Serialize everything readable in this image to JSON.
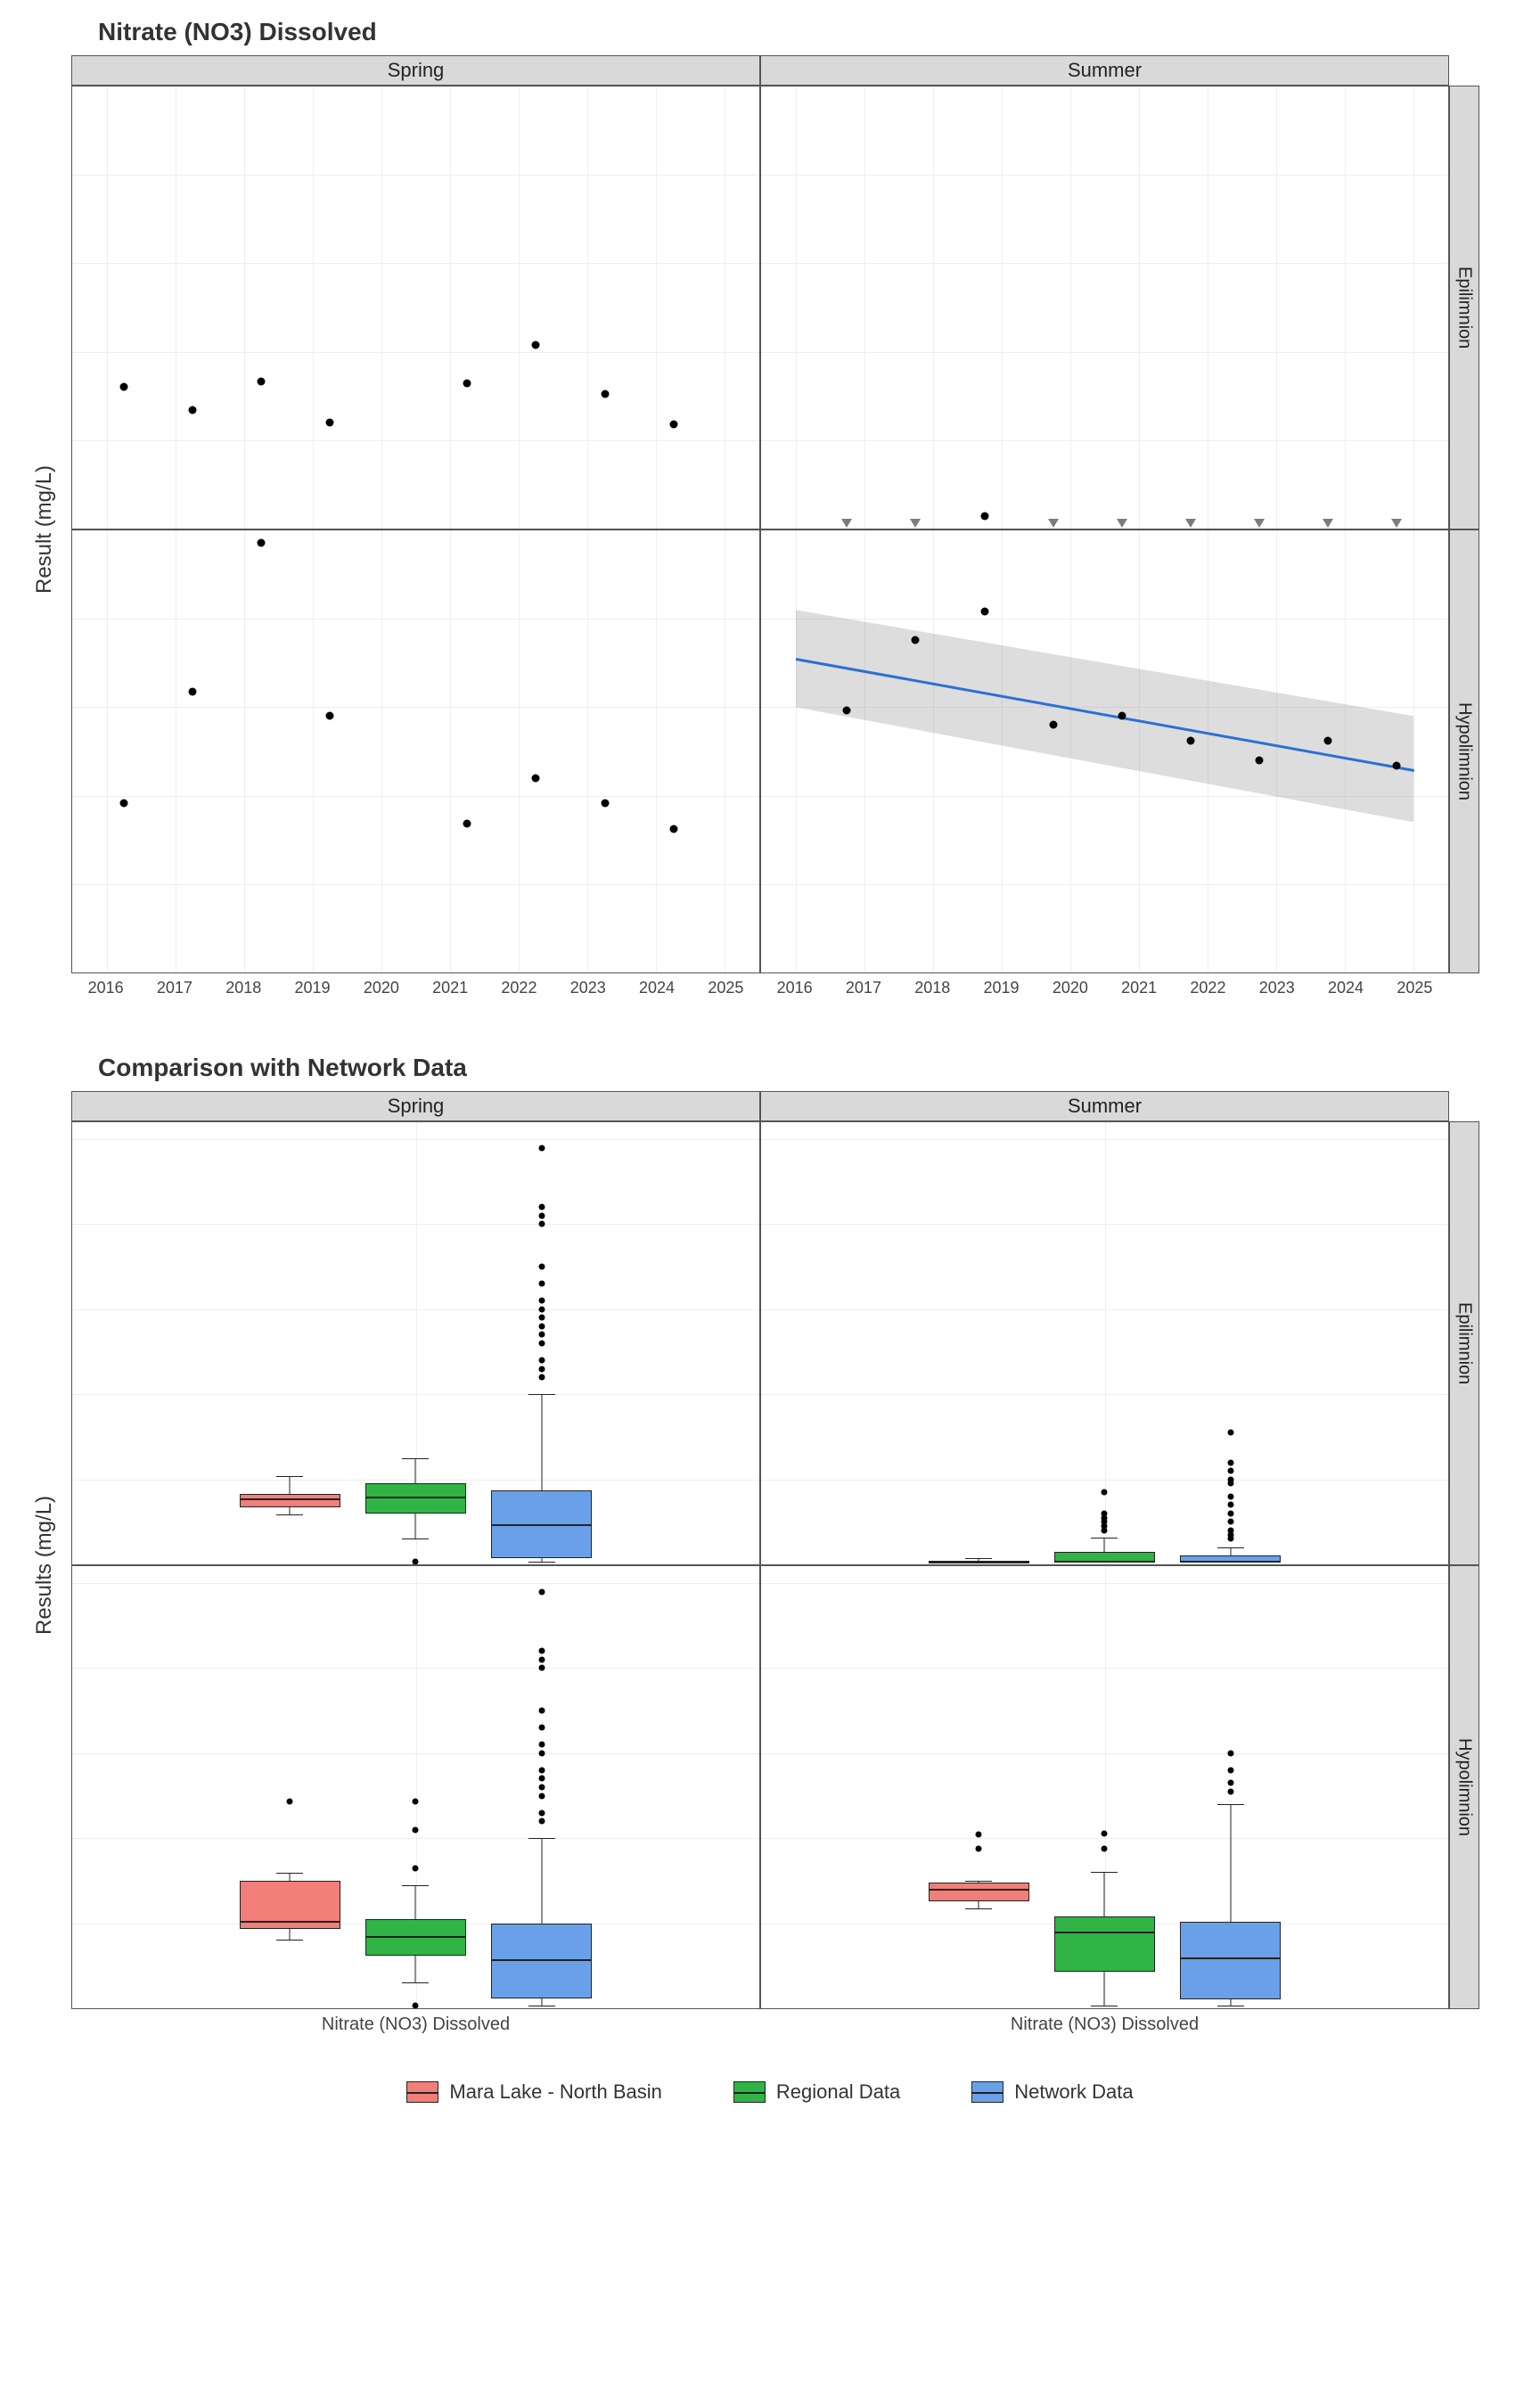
{
  "chart_data": [
    {
      "type": "scatter",
      "title": "Nitrate (NO3) Dissolved",
      "ylabel": "Result (mg/L)",
      "facet_cols": [
        "Spring",
        "Summer"
      ],
      "facet_rows": [
        "Epilimnion",
        "Hypolimnion"
      ],
      "xlim": [
        2015.5,
        2025.5
      ],
      "ylim": [
        0,
        0.25
      ],
      "x_ticks": [
        2016,
        2017,
        2018,
        2019,
        2020,
        2021,
        2022,
        2023,
        2024,
        2025
      ],
      "y_ticks": [
        0.0,
        0.05,
        0.1,
        0.15,
        0.2,
        0.25
      ],
      "panels": {
        "Spring_Epilimnion": {
          "points": [
            {
              "x": 2016.25,
              "y": 0.08
            },
            {
              "x": 2017.25,
              "y": 0.067
            },
            {
              "x": 2018.25,
              "y": 0.083
            },
            {
              "x": 2019.25,
              "y": 0.06
            },
            {
              "x": 2021.25,
              "y": 0.082
            },
            {
              "x": 2022.25,
              "y": 0.104
            },
            {
              "x": 2023.25,
              "y": 0.076
            },
            {
              "x": 2024.25,
              "y": 0.059
            }
          ]
        },
        "Summer_Epilimnion": {
          "points": [
            {
              "x": 2018.75,
              "y": 0.007
            }
          ],
          "open_points": [
            {
              "x": 2016.75,
              "y": 0.003
            },
            {
              "x": 2017.75,
              "y": 0.003
            },
            {
              "x": 2019.75,
              "y": 0.003
            },
            {
              "x": 2020.75,
              "y": 0.003
            },
            {
              "x": 2021.75,
              "y": 0.003
            },
            {
              "x": 2022.75,
              "y": 0.003
            },
            {
              "x": 2023.75,
              "y": 0.003
            },
            {
              "x": 2024.75,
              "y": 0.003
            }
          ]
        },
        "Spring_Hypolimnion": {
          "points": [
            {
              "x": 2016.25,
              "y": 0.096
            },
            {
              "x": 2017.25,
              "y": 0.159
            },
            {
              "x": 2018.25,
              "y": 0.243
            },
            {
              "x": 2019.25,
              "y": 0.145
            },
            {
              "x": 2021.25,
              "y": 0.084
            },
            {
              "x": 2022.25,
              "y": 0.11
            },
            {
              "x": 2023.25,
              "y": 0.096
            },
            {
              "x": 2024.25,
              "y": 0.081
            }
          ]
        },
        "Summer_Hypolimnion": {
          "points": [
            {
              "x": 2016.75,
              "y": 0.148
            },
            {
              "x": 2017.75,
              "y": 0.188
            },
            {
              "x": 2018.75,
              "y": 0.204
            },
            {
              "x": 2019.75,
              "y": 0.14
            },
            {
              "x": 2020.75,
              "y": 0.145
            },
            {
              "x": 2021.75,
              "y": 0.131
            },
            {
              "x": 2022.75,
              "y": 0.12
            },
            {
              "x": 2023.75,
              "y": 0.131
            },
            {
              "x": 2024.75,
              "y": 0.117
            }
          ],
          "trend": {
            "x1": 2016.0,
            "y1": 0.178,
            "x2": 2025.0,
            "y2": 0.115
          },
          "ci": {
            "x1": 2016.0,
            "x2": 2025.0,
            "y1_upper": 0.205,
            "y1_lower": 0.15,
            "y2_upper": 0.145,
            "y2_lower": 0.085
          }
        }
      }
    },
    {
      "type": "boxplot",
      "title": "Comparison with Network Data",
      "ylabel": "Results (mg/L)",
      "facet_cols": [
        "Spring",
        "Summer"
      ],
      "facet_rows": [
        "Epilimnion",
        "Hypolimnion"
      ],
      "x_category": "Nitrate (NO3) Dissolved",
      "ylim": [
        0,
        0.52
      ],
      "y_ticks": [
        0.0,
        0.1,
        0.2,
        0.3,
        0.4,
        0.5
      ],
      "legend": [
        {
          "label": "Mara Lake - North Basin",
          "color": "red"
        },
        {
          "label": "Regional Data",
          "color": "green"
        },
        {
          "label": "Network Data",
          "color": "blue"
        }
      ],
      "panels": {
        "Spring_Epilimnion": {
          "boxes": [
            {
              "group": "Mara Lake - North Basin",
              "min": 0.059,
              "q1": 0.067,
              "med": 0.078,
              "q3": 0.083,
              "max": 0.104
            },
            {
              "group": "Regional Data",
              "min": 0.03,
              "q1": 0.06,
              "med": 0.08,
              "q3": 0.095,
              "max": 0.125,
              "out": [
                0.003
              ]
            },
            {
              "group": "Network Data",
              "min": 0.003,
              "q1": 0.007,
              "med": 0.047,
              "q3": 0.087,
              "max": 0.2,
              "out": [
                0.22,
                0.23,
                0.24,
                0.26,
                0.27,
                0.28,
                0.29,
                0.3,
                0.31,
                0.33,
                0.35,
                0.4,
                0.41,
                0.42,
                0.49
              ]
            }
          ]
        },
        "Summer_Epilimnion": {
          "boxes": [
            {
              "group": "Mara Lake - North Basin",
              "min": 0.003,
              "q1": 0.003,
              "med": 0.003,
              "q3": 0.004,
              "max": 0.007
            },
            {
              "group": "Regional Data",
              "min": 0.003,
              "q1": 0.003,
              "med": 0.004,
              "q3": 0.015,
              "max": 0.031,
              "out": [
                0.04,
                0.045,
                0.05,
                0.055,
                0.06,
                0.085
              ]
            },
            {
              "group": "Network Data",
              "min": 0.003,
              "q1": 0.003,
              "med": 0.004,
              "q3": 0.01,
              "max": 0.02,
              "out": [
                0.03,
                0.035,
                0.04,
                0.05,
                0.06,
                0.07,
                0.08,
                0.095,
                0.1,
                0.11,
                0.12,
                0.155
              ]
            }
          ]
        },
        "Spring_Hypolimnion": {
          "boxes": [
            {
              "group": "Mara Lake - North Basin",
              "min": 0.081,
              "q1": 0.093,
              "med": 0.103,
              "q3": 0.15,
              "max": 0.159,
              "out": [
                0.243
              ]
            },
            {
              "group": "Regional Data",
              "min": 0.03,
              "q1": 0.062,
              "med": 0.085,
              "q3": 0.105,
              "max": 0.145,
              "out": [
                0.003,
                0.165,
                0.21,
                0.243
              ]
            },
            {
              "group": "Network Data",
              "min": 0.003,
              "q1": 0.012,
              "med": 0.058,
              "q3": 0.1,
              "max": 0.2,
              "out": [
                0.22,
                0.23,
                0.25,
                0.26,
                0.27,
                0.28,
                0.3,
                0.31,
                0.33,
                0.35,
                0.4,
                0.41,
                0.42,
                0.49
              ]
            }
          ]
        },
        "Summer_Hypolimnion": {
          "boxes": [
            {
              "group": "Mara Lake - North Basin",
              "min": 0.117,
              "q1": 0.126,
              "med": 0.14,
              "q3": 0.148,
              "max": 0.15,
              "out": [
                0.188,
                0.204
              ]
            },
            {
              "group": "Regional Data",
              "min": 0.003,
              "q1": 0.043,
              "med": 0.09,
              "q3": 0.108,
              "max": 0.16,
              "out": [
                0.188,
                0.205
              ]
            },
            {
              "group": "Network Data",
              "min": 0.003,
              "q1": 0.01,
              "med": 0.06,
              "q3": 0.102,
              "max": 0.24,
              "out": [
                0.255,
                0.265,
                0.28,
                0.3
              ]
            }
          ]
        }
      }
    }
  ]
}
